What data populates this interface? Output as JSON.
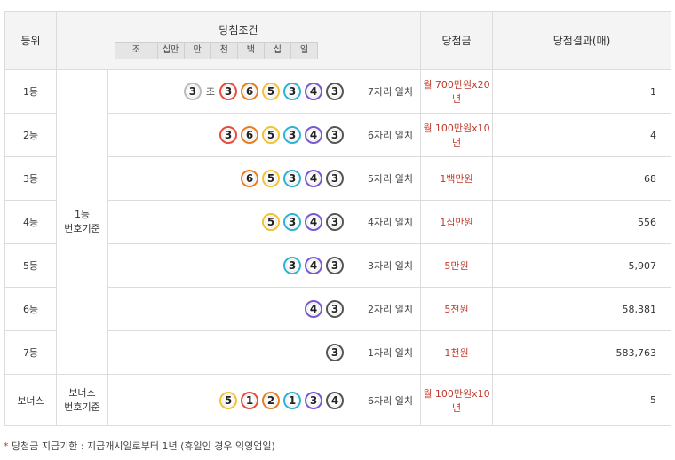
{
  "header": {
    "rank": "등위",
    "condition": "당첨조건",
    "prize": "당첨금",
    "result": "당첨결과(매)",
    "digits": [
      "조",
      "십만",
      "만",
      "천",
      "백",
      "십",
      "일"
    ]
  },
  "colors": {
    "prize_text": "#c0392b",
    "ball_1_3": "#555555",
    "ball_2_4": "#7b57d1",
    "ball_5": "#f1c232",
    "ball_6": "#e67e22",
    "ball_1": "#e74c3c",
    "ball_gray": "#bbbbbb",
    "ball_3_cyan": "#2fb2d4"
  },
  "basis": {
    "first": [
      "1등",
      "번호기준"
    ],
    "bonus": [
      "보너스",
      "번호기준"
    ]
  },
  "rows": [
    {
      "rank": "1등",
      "match": "7자리 일치",
      "prize": "월 700만원x20년",
      "count": "1"
    },
    {
      "rank": "2등",
      "match": "6자리 일치",
      "prize": "월 100만원x10년",
      "count": "4"
    },
    {
      "rank": "3등",
      "match": "5자리 일치",
      "prize": "1백만원",
      "count": "68"
    },
    {
      "rank": "4등",
      "match": "4자리 일치",
      "prize": "1십만원",
      "count": "556"
    },
    {
      "rank": "5등",
      "match": "3자리 일치",
      "prize": "5만원",
      "count": "5,907"
    },
    {
      "rank": "6등",
      "match": "2자리 일치",
      "prize": "5천원",
      "count": "58,381"
    },
    {
      "rank": "7등",
      "match": "1자리 일치",
      "prize": "1천원",
      "count": "583,763"
    },
    {
      "rank": "보너스",
      "match": "6자리 일치",
      "prize": "월 100만원x10년",
      "count": "5"
    }
  ],
  "balls": {
    "row1": [
      {
        "n": "3",
        "c": "#bbbbbb"
      },
      {
        "unit": "조"
      },
      {
        "n": "3",
        "c": "#e74c3c"
      },
      {
        "n": "6",
        "c": "#e67e22"
      },
      {
        "n": "5",
        "c": "#f1c232"
      },
      {
        "n": "3",
        "c": "#2fb2d4"
      },
      {
        "n": "4",
        "c": "#7b57d1"
      },
      {
        "n": "3",
        "c": "#555555"
      }
    ],
    "row2": [
      {
        "n": "3",
        "c": "#e74c3c"
      },
      {
        "n": "6",
        "c": "#e67e22"
      },
      {
        "n": "5",
        "c": "#f1c232"
      },
      {
        "n": "3",
        "c": "#2fb2d4"
      },
      {
        "n": "4",
        "c": "#7b57d1"
      },
      {
        "n": "3",
        "c": "#555555"
      }
    ],
    "row3": [
      {
        "n": "6",
        "c": "#e67e22"
      },
      {
        "n": "5",
        "c": "#f1c232"
      },
      {
        "n": "3",
        "c": "#2fb2d4"
      },
      {
        "n": "4",
        "c": "#7b57d1"
      },
      {
        "n": "3",
        "c": "#555555"
      }
    ],
    "row4": [
      {
        "n": "5",
        "c": "#f1c232"
      },
      {
        "n": "3",
        "c": "#2fb2d4"
      },
      {
        "n": "4",
        "c": "#7b57d1"
      },
      {
        "n": "3",
        "c": "#555555"
      }
    ],
    "row5": [
      {
        "n": "3",
        "c": "#2fb2d4"
      },
      {
        "n": "4",
        "c": "#7b57d1"
      },
      {
        "n": "3",
        "c": "#555555"
      }
    ],
    "row6": [
      {
        "n": "4",
        "c": "#7b57d1"
      },
      {
        "n": "3",
        "c": "#555555"
      }
    ],
    "row7": [
      {
        "n": "3",
        "c": "#555555"
      }
    ],
    "bonus": [
      {
        "n": "5",
        "c": "#f1c232"
      },
      {
        "n": "1",
        "c": "#e74c3c"
      },
      {
        "n": "2",
        "c": "#e67e22"
      },
      {
        "n": "1",
        "c": "#2fb2d4"
      },
      {
        "n": "3",
        "c": "#7b57d1"
      },
      {
        "n": "4",
        "c": "#555555"
      }
    ]
  },
  "note": {
    "star": "*",
    "text": "당첨금 지급기한 : 지급개시일로부터 1년 (휴일인 경우 익영업일)"
  }
}
